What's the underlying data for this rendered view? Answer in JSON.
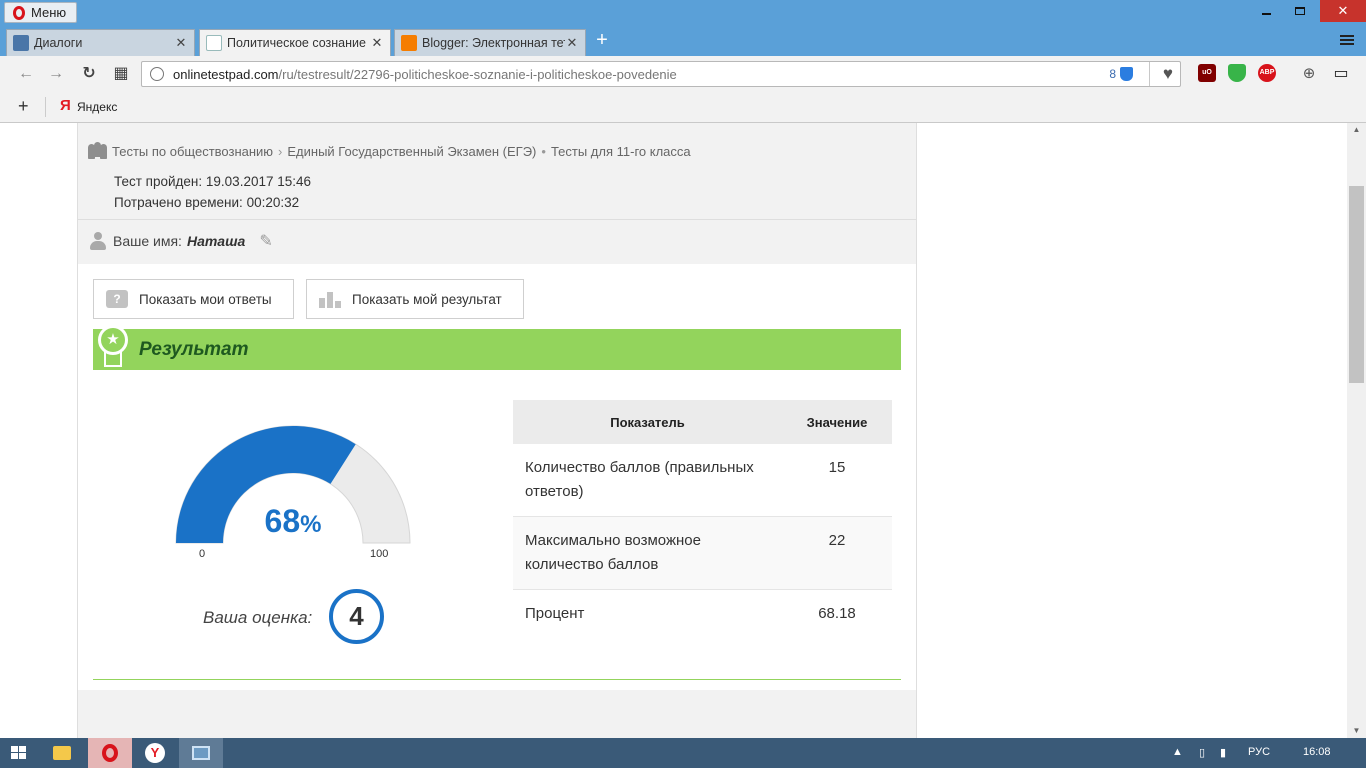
{
  "browser": {
    "menu_label": "Меню",
    "tabs": [
      {
        "label": "Диалоги"
      },
      {
        "label": "Политическое сознание и"
      },
      {
        "label": "Blogger: Электронная тетр"
      }
    ],
    "url_host": "onlinetestpad.com",
    "url_path": "/ru/testresult/22796-politicheskoe-soznanie-i-politicheskoe-povedenie",
    "shield_badge_count": "8",
    "extensions": [
      {
        "name": "ublock-icon",
        "text": "uO",
        "color": "#800000"
      },
      {
        "name": "ghostery-icon",
        "text": "",
        "color": "#38b449"
      },
      {
        "name": "adblock-icon",
        "text": "ABP",
        "color": "#d8131b"
      }
    ],
    "bookmarks": [
      {
        "label": "Яндекс"
      }
    ]
  },
  "page": {
    "breadcrumb": [
      "Тесты по обществознанию",
      "Единый Государственный Экзамен (ЕГЭ)",
      "Тесты для 11-го класса"
    ],
    "test_passed_label": "Тест пройден:",
    "test_passed_value": "19.03.2017 15:46",
    "time_spent_label": "Потрачено времени:",
    "time_spent_value": "00:20:32",
    "name_label": "Ваше имя:",
    "name_value": "Наташа",
    "show_answers_button": "Показать мои ответы",
    "show_result_button": "Показать мой результат",
    "result_title": "Результат",
    "gauge": {
      "percent": 68,
      "value_text": "68",
      "unit": "%",
      "min_label": "0",
      "max_label": "100",
      "fill_color": "#1a72c7",
      "track_color": "#ebebeb"
    },
    "grade_label": "Ваша оценка:",
    "grade_value": "4",
    "table": {
      "headers": [
        "Показатель",
        "Значение"
      ],
      "rows": [
        {
          "label": "Количество баллов (правильных ответов)",
          "value": "15"
        },
        {
          "label": "Максимально возможное количество баллов",
          "value": "22"
        },
        {
          "label": "Процент",
          "value": "68.18"
        }
      ]
    }
  },
  "taskbar": {
    "language": "РУС",
    "clock": "16:08"
  }
}
